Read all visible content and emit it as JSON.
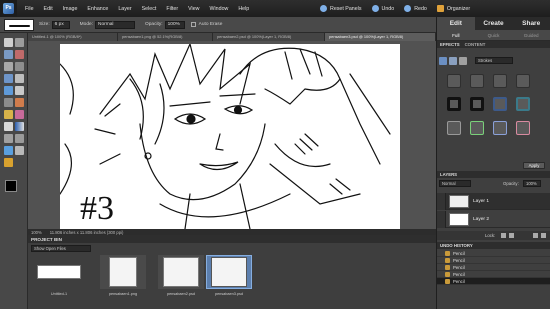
{
  "app": {
    "logo_text": "Ps"
  },
  "menubar": {
    "items": [
      "File",
      "Edit",
      "Image",
      "Enhance",
      "Layer",
      "Select",
      "Filter",
      "View",
      "Window",
      "Help"
    ],
    "right_items": [
      "Reset Panels",
      "Undo",
      "Redo",
      "Organizer"
    ]
  },
  "options": {
    "size_label": "Size:",
    "size_value": "6 px",
    "mode_label": "Mode:",
    "mode_value": "Normal",
    "opacity_label": "Opacity:",
    "opacity_value": "100%",
    "auto_erase_label": "Auto Erase"
  },
  "doc_tabs": [
    "Untitled-1 @ 100% (RGB/8*)",
    "pensabaen1.png @ 52.1%(RGB/8)",
    "pensabaen2.psd @ 100%(Layer 1, RGB/8)",
    "pensabaen3.psd @ 100%(Layer 1, RGB/8)"
  ],
  "active_doc_tab": 3,
  "status": {
    "zoom": "100%",
    "doc_size": "11.806 inches x 11.806 inches (300 ppi)"
  },
  "project_bin": {
    "title": "PROJECT BIN",
    "show_label": "Show Open Files",
    "items": [
      {
        "caption": "Untitled-1"
      },
      {
        "caption": "pensabaen1.png"
      },
      {
        "caption": "pensabaen2.psd"
      },
      {
        "caption": "pensabaen3.psd"
      }
    ]
  },
  "right_panel": {
    "mode_tabs": [
      "Edit",
      "Create",
      "Share"
    ],
    "sub_tabs": [
      "Full",
      "Quick",
      "Guided"
    ],
    "effects_tabs": [
      "EFFECTS",
      "CONTENT"
    ],
    "effects_dropdown": "Strokes",
    "apply_label": "Apply",
    "layers_title": "LAYERS",
    "blend_mode": "Normal",
    "layers_opacity_label": "Opacity:",
    "layers_opacity": "100%",
    "lock_label": "Lock:",
    "layers": [
      {
        "name": "Layer 1"
      },
      {
        "name": "Layer 2"
      }
    ],
    "undo_title": "UNDO HISTORY",
    "undo_items": [
      "Pencil",
      "Pencil",
      "Pencil",
      "Pencil",
      "Pencil"
    ]
  },
  "canvas": {
    "annotation": "#3"
  },
  "colors": {
    "accent": "#4f86c6",
    "panel": "#3f3f3f"
  }
}
